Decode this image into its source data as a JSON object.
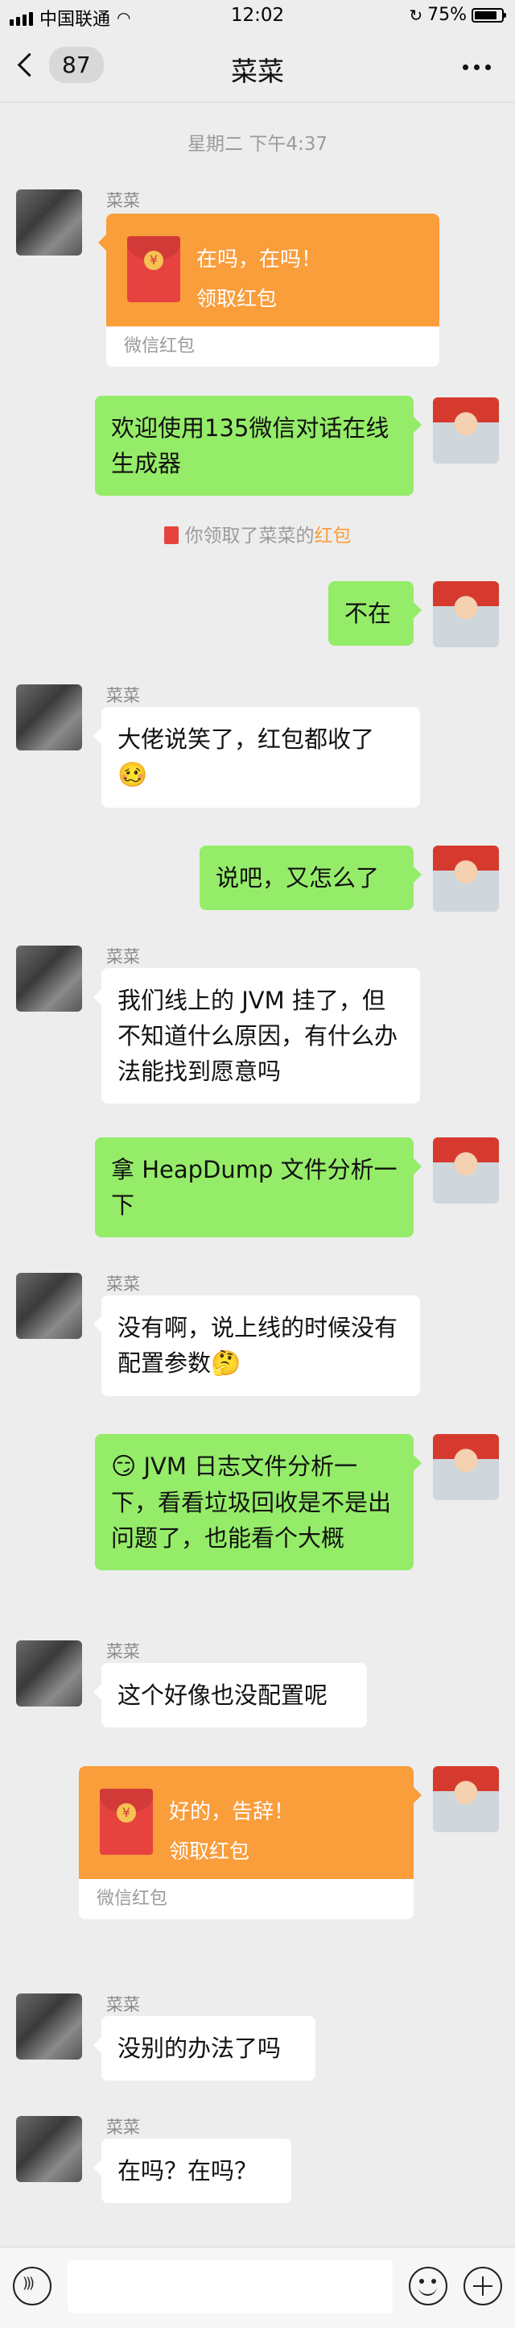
{
  "status_bar": {
    "carrier": "中国联通",
    "time": "12:02",
    "battery": "75%",
    "battery_level": 0.75
  },
  "nav": {
    "unread_count": "87",
    "title": "菜菜"
  },
  "chat": {
    "timestamp": "星期二 下午4:37",
    "friend_name": "菜菜",
    "messages": [
      {
        "from": "friend",
        "type": "redpacket",
        "text1": "在吗，在吗！",
        "text2": "领取红包",
        "footer": "微信红包"
      },
      {
        "from": "self",
        "type": "text",
        "text": "欢迎使用135微信对话在线生成器"
      },
      {
        "from": "system",
        "prefix": "你领取了菜菜的",
        "link": "红包"
      },
      {
        "from": "self",
        "type": "text",
        "text": "不在"
      },
      {
        "from": "friend",
        "type": "text",
        "text": "大佬说笑了，红包都收了",
        "emoji": "🥴"
      },
      {
        "from": "self",
        "type": "text",
        "text": "说吧，又怎么了"
      },
      {
        "from": "friend",
        "type": "text",
        "text": "我们线上的 JVM 挂了，但不知道什么原因，有什么办法能找到愿意吗"
      },
      {
        "from": "self",
        "type": "text",
        "text": "拿 HeapDump 文件分析一下"
      },
      {
        "from": "friend",
        "type": "text",
        "text": "没有啊，说上线的时候没有配置参数",
        "emoji": "🤔"
      },
      {
        "from": "self",
        "type": "text",
        "emoji": "😏",
        "text": " JVM 日志文件分析一下，看看垃圾回收是不是出问题了，也能看个大概"
      },
      {
        "from": "friend",
        "type": "text",
        "text": "这个好像也没配置呢"
      },
      {
        "from": "self",
        "type": "redpacket",
        "text1": "好的，告辞！",
        "text2": "领取红包",
        "footer": "微信红包"
      },
      {
        "from": "friend",
        "type": "text",
        "text": "没别的办法了吗"
      },
      {
        "from": "friend",
        "type": "text",
        "text": "在吗？在吗？"
      }
    ]
  },
  "input_bar": {
    "placeholder": ""
  },
  "colors": {
    "background": "#ededed",
    "bubble_self": "#95ec69",
    "bubble_friend": "#ffffff",
    "redpacket": "#fa9d3b"
  }
}
